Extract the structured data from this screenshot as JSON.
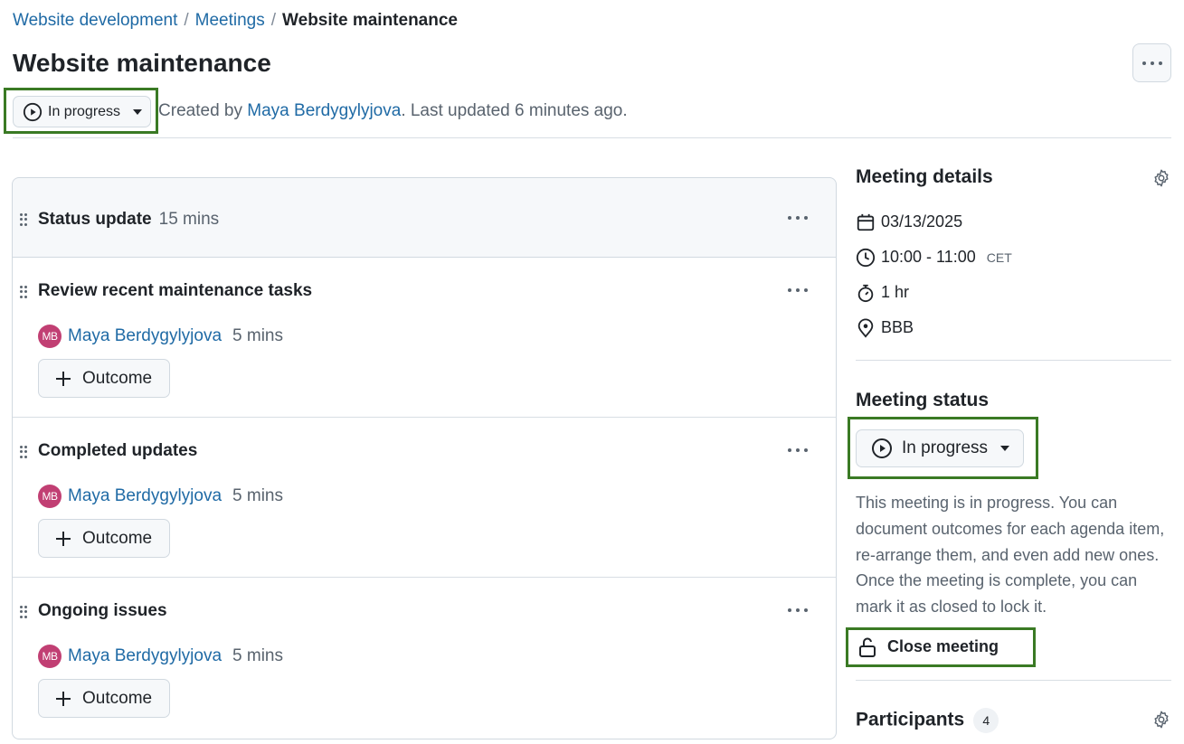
{
  "breadcrumb": {
    "items": [
      {
        "label": "Website development"
      },
      {
        "label": "Meetings"
      }
    ],
    "separator": "/",
    "current": "Website maintenance"
  },
  "page": {
    "title": "Website maintenance",
    "status_label": "In progress",
    "meta_prefix": "Created by ",
    "author": "Maya Berdygylyjova",
    "meta_suffix": ". Last updated 6 minutes ago."
  },
  "agenda": {
    "section": {
      "title": "Status update",
      "duration": "15 mins"
    },
    "items": [
      {
        "title": "Review recent maintenance tasks",
        "presenter_initials": "MB",
        "presenter": "Maya Berdygylyjova",
        "duration": "5 mins",
        "outcome_label": "Outcome"
      },
      {
        "title": "Completed updates",
        "presenter_initials": "MB",
        "presenter": "Maya Berdygylyjova",
        "duration": "5 mins",
        "outcome_label": "Outcome"
      },
      {
        "title": "Ongoing issues",
        "presenter_initials": "MB",
        "presenter": "Maya Berdygylyjova",
        "duration": "5 mins",
        "outcome_label": "Outcome"
      }
    ]
  },
  "sidebar": {
    "details": {
      "heading": "Meeting details",
      "date": "03/13/2025",
      "time": "10:00 - 11:00",
      "timezone": "CET",
      "duration": "1 hr",
      "location": "BBB"
    },
    "status": {
      "heading": "Meeting status",
      "status_label": "In progress",
      "description": "This meeting is in progress. You can document outcomes for each agenda item, re-arrange them, and even add new ones. Once the meeting is complete, you can mark it as closed to lock it.",
      "close_label": "Close meeting"
    },
    "participants": {
      "heading": "Participants",
      "count": "4"
    }
  },
  "colors": {
    "link": "#1f6aa5",
    "highlight": "#3a7a24",
    "avatar": "#c13f73"
  }
}
